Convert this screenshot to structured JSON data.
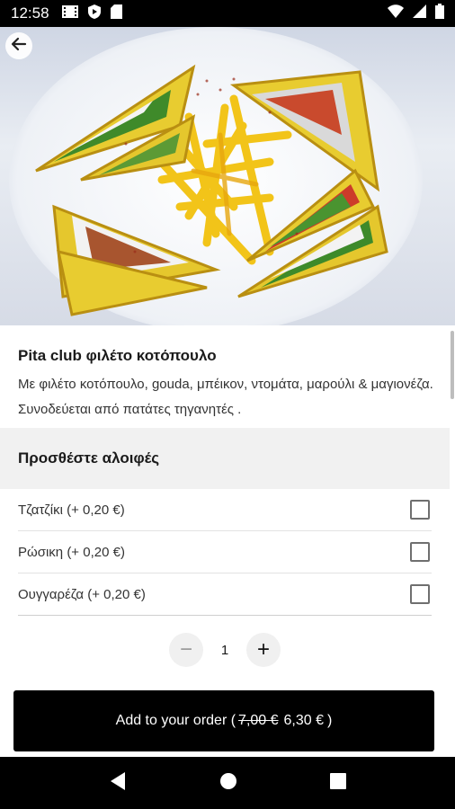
{
  "status_bar": {
    "time": "12:58",
    "icons_left": [
      "film-icon",
      "shield-play-icon",
      "sd-card-icon"
    ],
    "icons_right": [
      "wifi-icon",
      "signal-icon",
      "battery-icon"
    ]
  },
  "hero": {
    "image": "club-sandwich-with-fries-photo"
  },
  "item": {
    "title": "Pita club φιλέτο κοτόπουλο",
    "description": "Με φιλέτο κοτόπουλο, gouda, μπέικον, ντομάτα, μαρούλι & μαγιονέζα. Συνοδεύεται από πατάτες τηγανητές ."
  },
  "extras": {
    "header": "Προσθέστε αλοιφές",
    "options": [
      {
        "label": "Τζατζίκι (+ 0,20 €)",
        "checked": false
      },
      {
        "label": "Ρώσικη (+ 0,20 €)",
        "checked": false
      },
      {
        "label": "Ουγγαρέζα (+ 0,20 €)",
        "checked": false
      }
    ]
  },
  "quantity": {
    "value": "1",
    "minus": "−",
    "plus": "+"
  },
  "order": {
    "label_prefix": "Add to your order (",
    "old_price": "7,00 €",
    "new_price": "6,30 €",
    "label_suffix": ")"
  },
  "colors": {
    "primary": "#000000",
    "section_bg": "#f1f1f1"
  }
}
